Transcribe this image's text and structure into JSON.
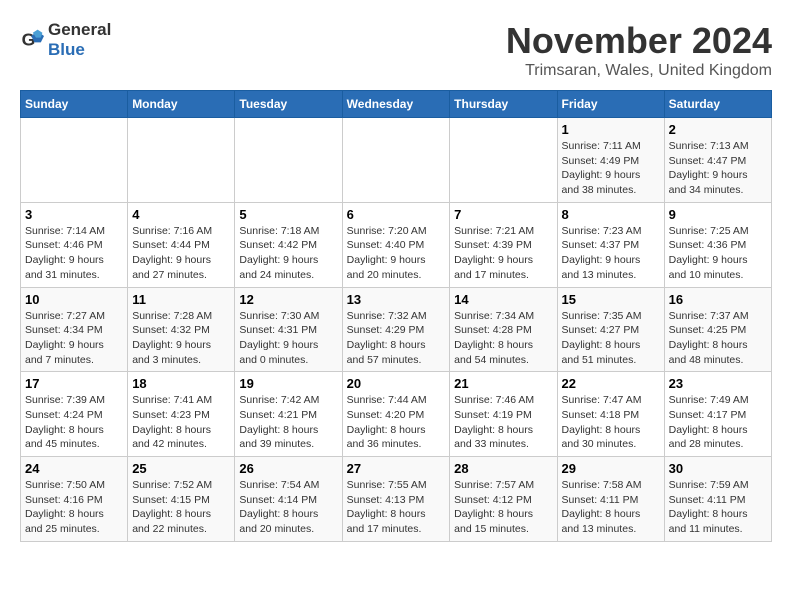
{
  "logo": {
    "general": "General",
    "blue": "Blue"
  },
  "title": {
    "month": "November 2024",
    "location": "Trimsaran, Wales, United Kingdom"
  },
  "weekdays": [
    "Sunday",
    "Monday",
    "Tuesday",
    "Wednesday",
    "Thursday",
    "Friday",
    "Saturday"
  ],
  "weeks": [
    [
      {
        "day": "",
        "info": ""
      },
      {
        "day": "",
        "info": ""
      },
      {
        "day": "",
        "info": ""
      },
      {
        "day": "",
        "info": ""
      },
      {
        "day": "",
        "info": ""
      },
      {
        "day": "1",
        "info": "Sunrise: 7:11 AM\nSunset: 4:49 PM\nDaylight: 9 hours\nand 38 minutes."
      },
      {
        "day": "2",
        "info": "Sunrise: 7:13 AM\nSunset: 4:47 PM\nDaylight: 9 hours\nand 34 minutes."
      }
    ],
    [
      {
        "day": "3",
        "info": "Sunrise: 7:14 AM\nSunset: 4:46 PM\nDaylight: 9 hours\nand 31 minutes."
      },
      {
        "day": "4",
        "info": "Sunrise: 7:16 AM\nSunset: 4:44 PM\nDaylight: 9 hours\nand 27 minutes."
      },
      {
        "day": "5",
        "info": "Sunrise: 7:18 AM\nSunset: 4:42 PM\nDaylight: 9 hours\nand 24 minutes."
      },
      {
        "day": "6",
        "info": "Sunrise: 7:20 AM\nSunset: 4:40 PM\nDaylight: 9 hours\nand 20 minutes."
      },
      {
        "day": "7",
        "info": "Sunrise: 7:21 AM\nSunset: 4:39 PM\nDaylight: 9 hours\nand 17 minutes."
      },
      {
        "day": "8",
        "info": "Sunrise: 7:23 AM\nSunset: 4:37 PM\nDaylight: 9 hours\nand 13 minutes."
      },
      {
        "day": "9",
        "info": "Sunrise: 7:25 AM\nSunset: 4:36 PM\nDaylight: 9 hours\nand 10 minutes."
      }
    ],
    [
      {
        "day": "10",
        "info": "Sunrise: 7:27 AM\nSunset: 4:34 PM\nDaylight: 9 hours\nand 7 minutes."
      },
      {
        "day": "11",
        "info": "Sunrise: 7:28 AM\nSunset: 4:32 PM\nDaylight: 9 hours\nand 3 minutes."
      },
      {
        "day": "12",
        "info": "Sunrise: 7:30 AM\nSunset: 4:31 PM\nDaylight: 9 hours\nand 0 minutes."
      },
      {
        "day": "13",
        "info": "Sunrise: 7:32 AM\nSunset: 4:29 PM\nDaylight: 8 hours\nand 57 minutes."
      },
      {
        "day": "14",
        "info": "Sunrise: 7:34 AM\nSunset: 4:28 PM\nDaylight: 8 hours\nand 54 minutes."
      },
      {
        "day": "15",
        "info": "Sunrise: 7:35 AM\nSunset: 4:27 PM\nDaylight: 8 hours\nand 51 minutes."
      },
      {
        "day": "16",
        "info": "Sunrise: 7:37 AM\nSunset: 4:25 PM\nDaylight: 8 hours\nand 48 minutes."
      }
    ],
    [
      {
        "day": "17",
        "info": "Sunrise: 7:39 AM\nSunset: 4:24 PM\nDaylight: 8 hours\nand 45 minutes."
      },
      {
        "day": "18",
        "info": "Sunrise: 7:41 AM\nSunset: 4:23 PM\nDaylight: 8 hours\nand 42 minutes."
      },
      {
        "day": "19",
        "info": "Sunrise: 7:42 AM\nSunset: 4:21 PM\nDaylight: 8 hours\nand 39 minutes."
      },
      {
        "day": "20",
        "info": "Sunrise: 7:44 AM\nSunset: 4:20 PM\nDaylight: 8 hours\nand 36 minutes."
      },
      {
        "day": "21",
        "info": "Sunrise: 7:46 AM\nSunset: 4:19 PM\nDaylight: 8 hours\nand 33 minutes."
      },
      {
        "day": "22",
        "info": "Sunrise: 7:47 AM\nSunset: 4:18 PM\nDaylight: 8 hours\nand 30 minutes."
      },
      {
        "day": "23",
        "info": "Sunrise: 7:49 AM\nSunset: 4:17 PM\nDaylight: 8 hours\nand 28 minutes."
      }
    ],
    [
      {
        "day": "24",
        "info": "Sunrise: 7:50 AM\nSunset: 4:16 PM\nDaylight: 8 hours\nand 25 minutes."
      },
      {
        "day": "25",
        "info": "Sunrise: 7:52 AM\nSunset: 4:15 PM\nDaylight: 8 hours\nand 22 minutes."
      },
      {
        "day": "26",
        "info": "Sunrise: 7:54 AM\nSunset: 4:14 PM\nDaylight: 8 hours\nand 20 minutes."
      },
      {
        "day": "27",
        "info": "Sunrise: 7:55 AM\nSunset: 4:13 PM\nDaylight: 8 hours\nand 17 minutes."
      },
      {
        "day": "28",
        "info": "Sunrise: 7:57 AM\nSunset: 4:12 PM\nDaylight: 8 hours\nand 15 minutes."
      },
      {
        "day": "29",
        "info": "Sunrise: 7:58 AM\nSunset: 4:11 PM\nDaylight: 8 hours\nand 13 minutes."
      },
      {
        "day": "30",
        "info": "Sunrise: 7:59 AM\nSunset: 4:11 PM\nDaylight: 8 hours\nand 11 minutes."
      }
    ]
  ]
}
